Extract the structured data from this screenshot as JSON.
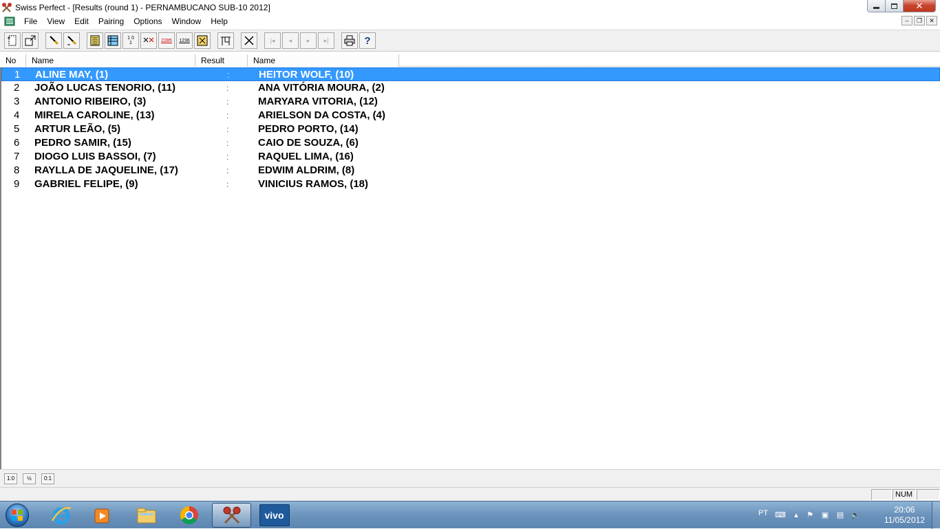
{
  "window": {
    "title": "Swiss Perfect - [Results  (round 1) - PERNAMBUCANO SUB-10 2012]"
  },
  "menu": [
    "File",
    "View",
    "Edit",
    "Pairing",
    "Options",
    "Window",
    "Help"
  ],
  "toolbar": {
    "tb3_label": "1 0 1",
    "tb5_label": "2285",
    "tb6_label": "1236"
  },
  "columns": {
    "no": "No",
    "white_name": "Name",
    "result": "Result",
    "black_name": "Name"
  },
  "rows": [
    {
      "no": "1",
      "white": "ALINE MAY,  (1)",
      "result": ":",
      "black": "HEITOR WOLF,  (10)"
    },
    {
      "no": "2",
      "white": "JOÃO LUCAS TENORIO,  (11)",
      "result": ":",
      "black": "ANA VITÓRIA MOURA,  (2)"
    },
    {
      "no": "3",
      "white": "ANTONIO RIBEIRO,  (3)",
      "result": ":",
      "black": "MARYARA VITORIA,  (12)"
    },
    {
      "no": "4",
      "white": "MIRELA CAROLINE,  (13)",
      "result": ":",
      "black": "ARIELSON DA COSTA,  (4)"
    },
    {
      "no": "5",
      "white": "ARTUR LEÃO,  (5)",
      "result": ":",
      "black": "PEDRO PORTO,  (14)"
    },
    {
      "no": "6",
      "white": "PEDRO SAMIR,  (15)",
      "result": ":",
      "black": "CAIO DE SOUZA,  (6)"
    },
    {
      "no": "7",
      "white": "DIOGO LUIS BASSOI,  (7)",
      "result": ":",
      "black": "RAQUEL LIMA,  (16)"
    },
    {
      "no": "8",
      "white": "RAYLLA DE JAQUELINE,  (17)",
      "result": ":",
      "black": "EDWIM ALDRIM,  (8)"
    },
    {
      "no": "9",
      "white": "GABRIEL FELIPE,  (9)",
      "result": ":",
      "black": "VINICIUS RAMOS,  (18)"
    }
  ],
  "bottom_buttons": [
    "1:0",
    "½",
    "0:1"
  ],
  "status": {
    "num": "NUM"
  },
  "taskbar": {
    "language": "PT",
    "time": "20:06",
    "date": "11/05/2012",
    "vivo_label": "vivo"
  },
  "colors": {
    "selection": "#3399ff",
    "taskbar": "#6b93bb"
  }
}
